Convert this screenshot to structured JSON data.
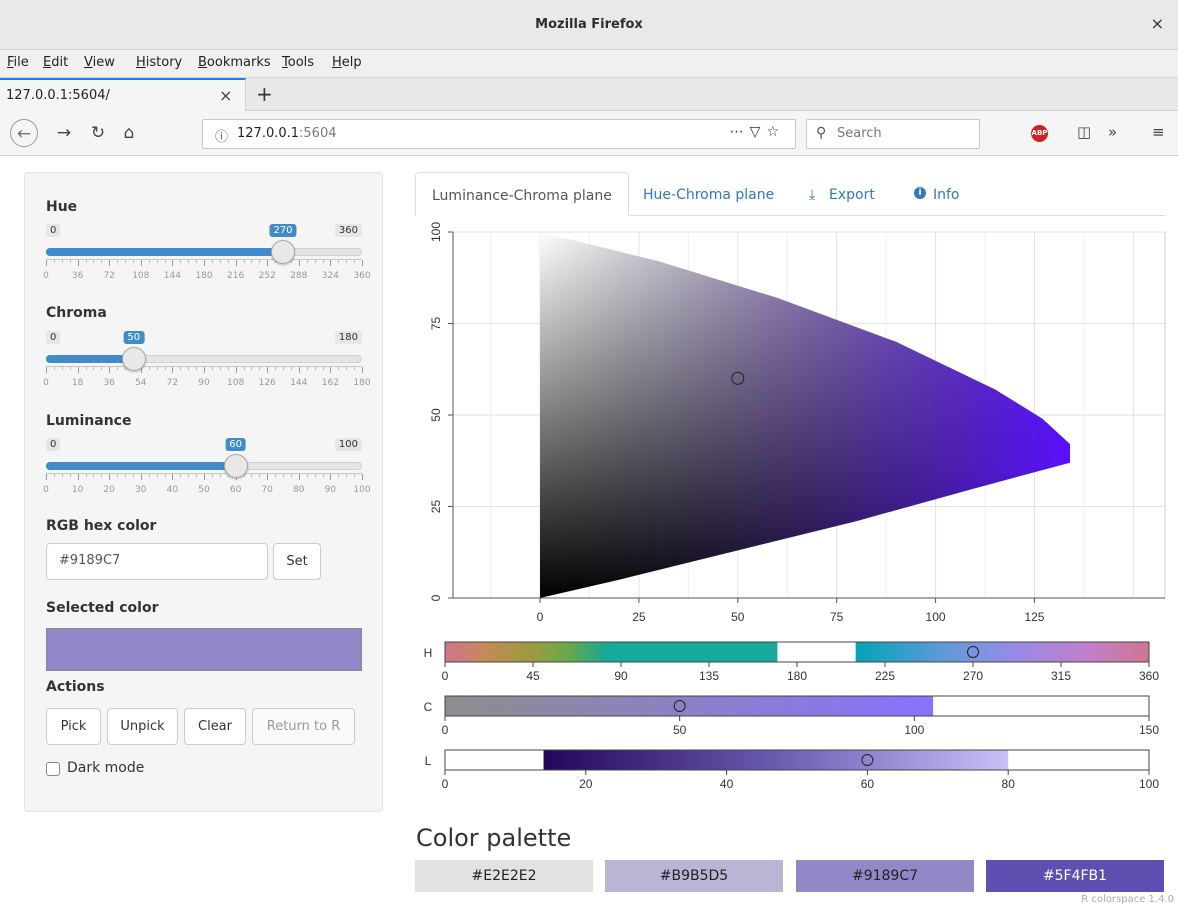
{
  "window": {
    "title": "Mozilla Firefox",
    "close_glyph": "×"
  },
  "menubar": [
    "File",
    "Edit",
    "View",
    "History",
    "Bookmarks",
    "Tools",
    "Help"
  ],
  "tab": {
    "label": "127.0.0.1:5604/",
    "close_glyph": "×",
    "new_tab_glyph": "+"
  },
  "navbar": {
    "url_host": "127.0.0.1",
    "url_port": ":5604",
    "search_placeholder": "Search",
    "abp_label": "ABP"
  },
  "sliders": {
    "hue": {
      "label": "Hue",
      "min": 0,
      "max": 360,
      "value": 270,
      "ticks": [
        0,
        36,
        72,
        108,
        144,
        180,
        216,
        252,
        288,
        324,
        360
      ]
    },
    "chroma": {
      "label": "Chroma",
      "min": 0,
      "max": 180,
      "value": 50,
      "ticks": [
        0,
        18,
        36,
        54,
        72,
        90,
        108,
        126,
        144,
        162,
        180
      ]
    },
    "luminance": {
      "label": "Luminance",
      "min": 0,
      "max": 100,
      "value": 60,
      "ticks": [
        0,
        10,
        20,
        30,
        40,
        50,
        60,
        70,
        80,
        90,
        100
      ]
    }
  },
  "hex": {
    "label": "RGB hex color",
    "value": "#9189C7",
    "set_label": "Set"
  },
  "selected": {
    "label": "Selected color",
    "color": "#9189C7"
  },
  "actions": {
    "label": "Actions",
    "pick": "Pick",
    "unpick": "Unpick",
    "clear": "Clear",
    "return": "Return to R"
  },
  "dark_mode": {
    "label": "Dark mode",
    "checked": false
  },
  "tabs": [
    "Luminance-Chroma plane",
    "Hue-Chroma plane",
    "Export",
    "Info"
  ],
  "chart_data": {
    "type": "scatter",
    "title": "",
    "xlabel": "",
    "ylabel": "",
    "xlim": [
      -22,
      158
    ],
    "ylim": [
      0,
      100
    ],
    "x_ticks": [
      0,
      25,
      50,
      75,
      100,
      125
    ],
    "y_ticks": [
      0,
      25,
      50,
      75,
      100
    ],
    "grid": true,
    "point": {
      "x": 50,
      "y": 60
    },
    "gamut_hue": 270
  },
  "strips": {
    "H": {
      "label": "H",
      "min": 0,
      "max": 360,
      "ticks": [
        0,
        45,
        90,
        135,
        180,
        225,
        270,
        315,
        360
      ],
      "marker": 270,
      "gap": [
        170,
        210
      ]
    },
    "C": {
      "label": "C",
      "min": 0,
      "max": 150,
      "ticks": [
        0,
        50,
        100,
        150
      ],
      "marker": 50,
      "filled_to": 104
    },
    "L": {
      "label": "L",
      "min": 0,
      "max": 100,
      "ticks": [
        0,
        20,
        40,
        60,
        80,
        100
      ],
      "marker": 60,
      "range": [
        14,
        80
      ]
    }
  },
  "palette": {
    "title": "Color palette",
    "colors": [
      "#E2E2E2",
      "#B9B5D5",
      "#9189C7",
      "#5F4FB1"
    ]
  },
  "footer": {
    "version": "R colorspace 1.4.0"
  }
}
